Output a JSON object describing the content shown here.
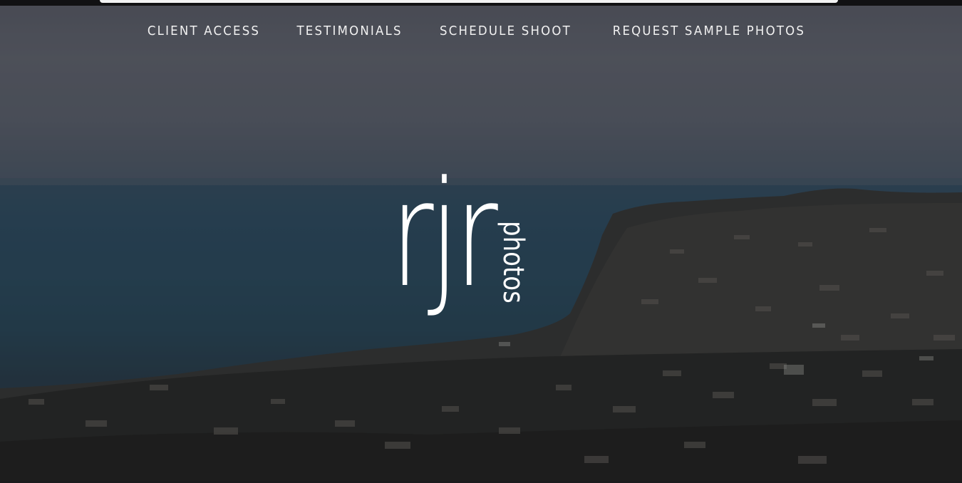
{
  "nav": {
    "items": [
      {
        "label": "CLIENT ACCESS"
      },
      {
        "label": "TESTIMONIALS"
      },
      {
        "label": "SCHEDULE SHOOT"
      },
      {
        "label": "REQUEST SAMPLE PHOTOS"
      }
    ]
  },
  "logo": {
    "main": "rjr",
    "sub": "photos"
  },
  "colors": {
    "nav_text": "#f1f1f1",
    "logo": "#ffffff",
    "ocean": "#2f5066",
    "sky": "#5f636d"
  }
}
